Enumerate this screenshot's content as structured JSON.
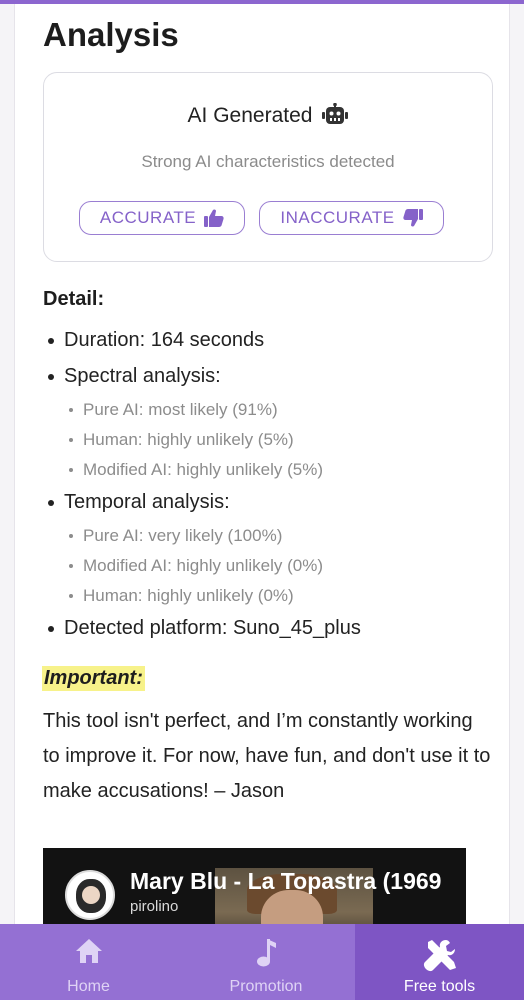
{
  "colors": {
    "accent": "#8c66cf",
    "nav_bg": "#9470d3",
    "nav_active": "#7e55c4",
    "highlight": "#f7f28a"
  },
  "page_title": "Analysis",
  "result": {
    "label": "AI Generated",
    "icon": "robot-icon",
    "subtitle": "Strong AI characteristics detected",
    "accurate_label": "ACCURATE",
    "accurate_icon": "thumbs-up-icon",
    "inaccurate_label": "INACCURATE",
    "inaccurate_icon": "thumbs-down-icon"
  },
  "detail": {
    "heading": "Detail:",
    "duration": "Duration: 164 seconds",
    "spectral": {
      "label": "Spectral analysis:",
      "items": [
        "Pure AI: most likely (91%)",
        "Human: highly unlikely (5%)",
        "Modified AI: highly unlikely (5%)"
      ]
    },
    "temporal": {
      "label": "Temporal analysis:",
      "items": [
        "Pure AI: very likely (100%)",
        "Modified AI: highly unlikely (0%)",
        "Human: highly unlikely (0%)"
      ]
    },
    "platform": "Detected platform: Suno_45_plus"
  },
  "important": {
    "label": "Important:",
    "text": "This tool isn't perfect, and I’m constantly working to improve it. For now, have fun, and don't use it to make accusations! – Jason"
  },
  "video": {
    "title": "Mary Blu - La Topastra (1969",
    "channel": "pirolino"
  },
  "nav": {
    "home": {
      "label": "Home",
      "icon": "home-icon"
    },
    "promotion": {
      "label": "Promotion",
      "icon": "music-note-icon"
    },
    "tools": {
      "label": "Free tools",
      "icon": "tools-icon",
      "active": true
    }
  }
}
